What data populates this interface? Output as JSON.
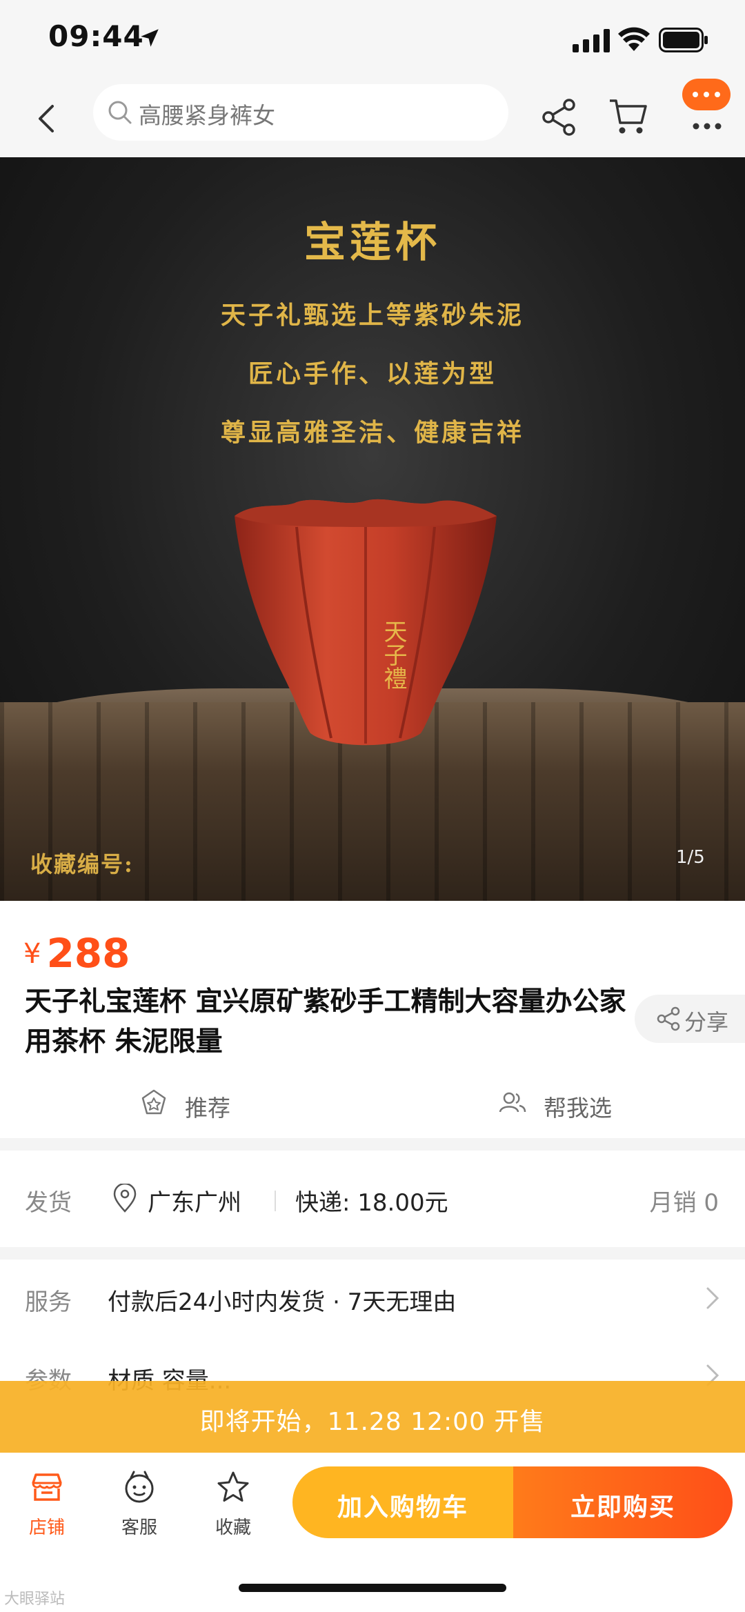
{
  "status_bar": {
    "time": "09:44",
    "icons": [
      "location-arrow-icon",
      "signal-icon",
      "wifi-icon",
      "battery-icon"
    ]
  },
  "nav": {
    "search_placeholder": "高腰紧身裤女",
    "icons": [
      "back-icon",
      "search-icon",
      "share-icon",
      "cart-icon",
      "more-icon"
    ]
  },
  "hero": {
    "title": "宝莲杯",
    "lines": [
      "天子礼甄选上等紫砂朱泥",
      "匠心手作、以莲为型",
      "尊显高雅圣洁、健康吉祥"
    ],
    "cup_inscription": "天子禮",
    "caption": "收藏编号:",
    "counter": "1/5"
  },
  "product": {
    "price_symbol": "¥",
    "price": "288",
    "title": "天子礼宝莲杯 宜兴原矿紫砂手工精制大容量办公家用茶杯 朱泥限量",
    "share_label": "分享",
    "recommend_label": "推荐",
    "help_choose_label": "帮我选"
  },
  "shipping": {
    "label": "发货",
    "location": "广东广州",
    "fee": "快递: 18.00元",
    "monthly_sales": "月销 0"
  },
  "service": {
    "label": "服务",
    "text": "付款后24小时内发货 · 7天无理由"
  },
  "params": {
    "label": "参数",
    "text": "材质 容量..."
  },
  "banner": {
    "text": "即将开始，11.28 12:00 开售"
  },
  "bottom_bar": {
    "tabs": [
      {
        "label": "店铺",
        "icon": "shop-icon"
      },
      {
        "label": "客服",
        "icon": "customer-service-icon"
      },
      {
        "label": "收藏",
        "icon": "star-icon"
      }
    ],
    "add_to_cart": "加入购物车",
    "buy_now": "立即购买"
  },
  "colors": {
    "accent": "#ff4f18",
    "banner": "#f7b026",
    "cart_button": "#ffb521",
    "gold_text": "#e0b548",
    "cup_red": "#c9402a"
  },
  "watermark": "大眼驿站"
}
